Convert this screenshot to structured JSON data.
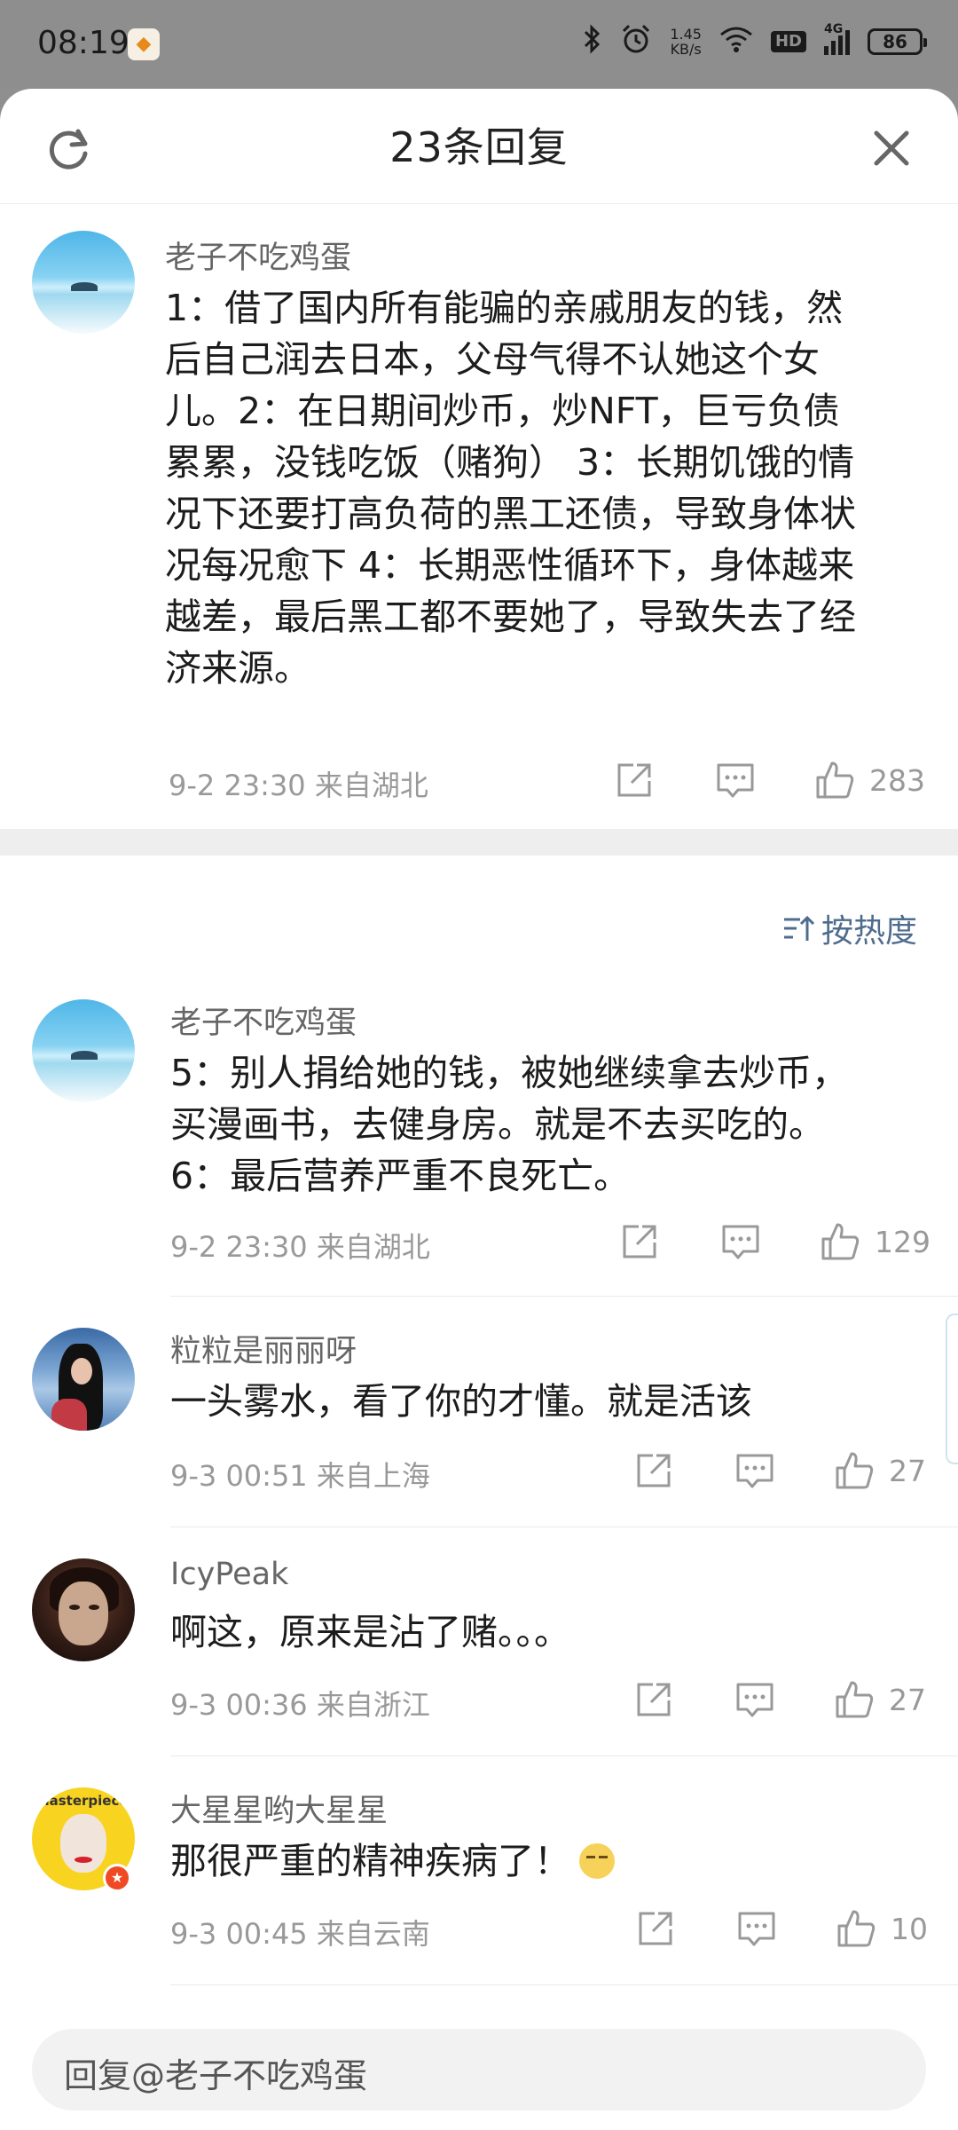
{
  "status_bar": {
    "time": "08:19",
    "net_speed_value": "1.45",
    "net_speed_unit": "KB/s",
    "signal_type": "4G",
    "hd_label": "HD",
    "battery": "86"
  },
  "header": {
    "title": "23条回复"
  },
  "root_comment": {
    "username": "老子不吃鸡蛋",
    "text_lines": [
      "1：借了国内所有能骗的亲戚朋友的钱，然",
      "后自己润去日本，父母气得不认她这个女",
      "儿。2：在日期间炒币，炒NFT，巨亏负债",
      "累累，没钱吃饭（赌狗） 3：长期饥饿的情",
      "况下还要打高负荷的黑工还债，导致身体状",
      "况每况愈下 4：长期恶性循环下，身体越来",
      "越差，最后黑工都不要她了，导致失去了经",
      "济来源。"
    ],
    "meta": "9-2 23:30  来自湖北",
    "likes": "283"
  },
  "sort": {
    "label": "按热度"
  },
  "replies": [
    {
      "username": "老子不吃鸡蛋",
      "text_lines": [
        "5：别人捐给她的钱，被她继续拿去炒币，",
        "买漫画书，去健身房。就是不去买吃的。",
        "6：最后营养严重不良死亡。"
      ],
      "meta": "9-2 23:30  来自湖北",
      "likes": "129"
    },
    {
      "username": "粒粒是丽丽呀",
      "text_lines": [
        "一头雾水，看了你的才懂。就是活该"
      ],
      "meta": "9-3 00:51  来自上海",
      "likes": "27"
    },
    {
      "username": "IcyPeak",
      "text_lines": [
        "啊这，原来是沾了赌。。。"
      ],
      "meta": "9-3 00:36  来自浙江",
      "likes": "27"
    },
    {
      "username": "大星星哟大星星",
      "text_lines": [
        "那很严重的精神疾病了！"
      ],
      "avatar_text": "masterpiece",
      "meta": "9-3 00:45  来自云南",
      "likes": "10"
    }
  ],
  "reply_bar": {
    "placeholder": "回复@老子不吃鸡蛋"
  },
  "colors": {
    "accent_link": "#4f6c8e",
    "muted_text": "#999999",
    "verified_badge": "#f04a24"
  }
}
